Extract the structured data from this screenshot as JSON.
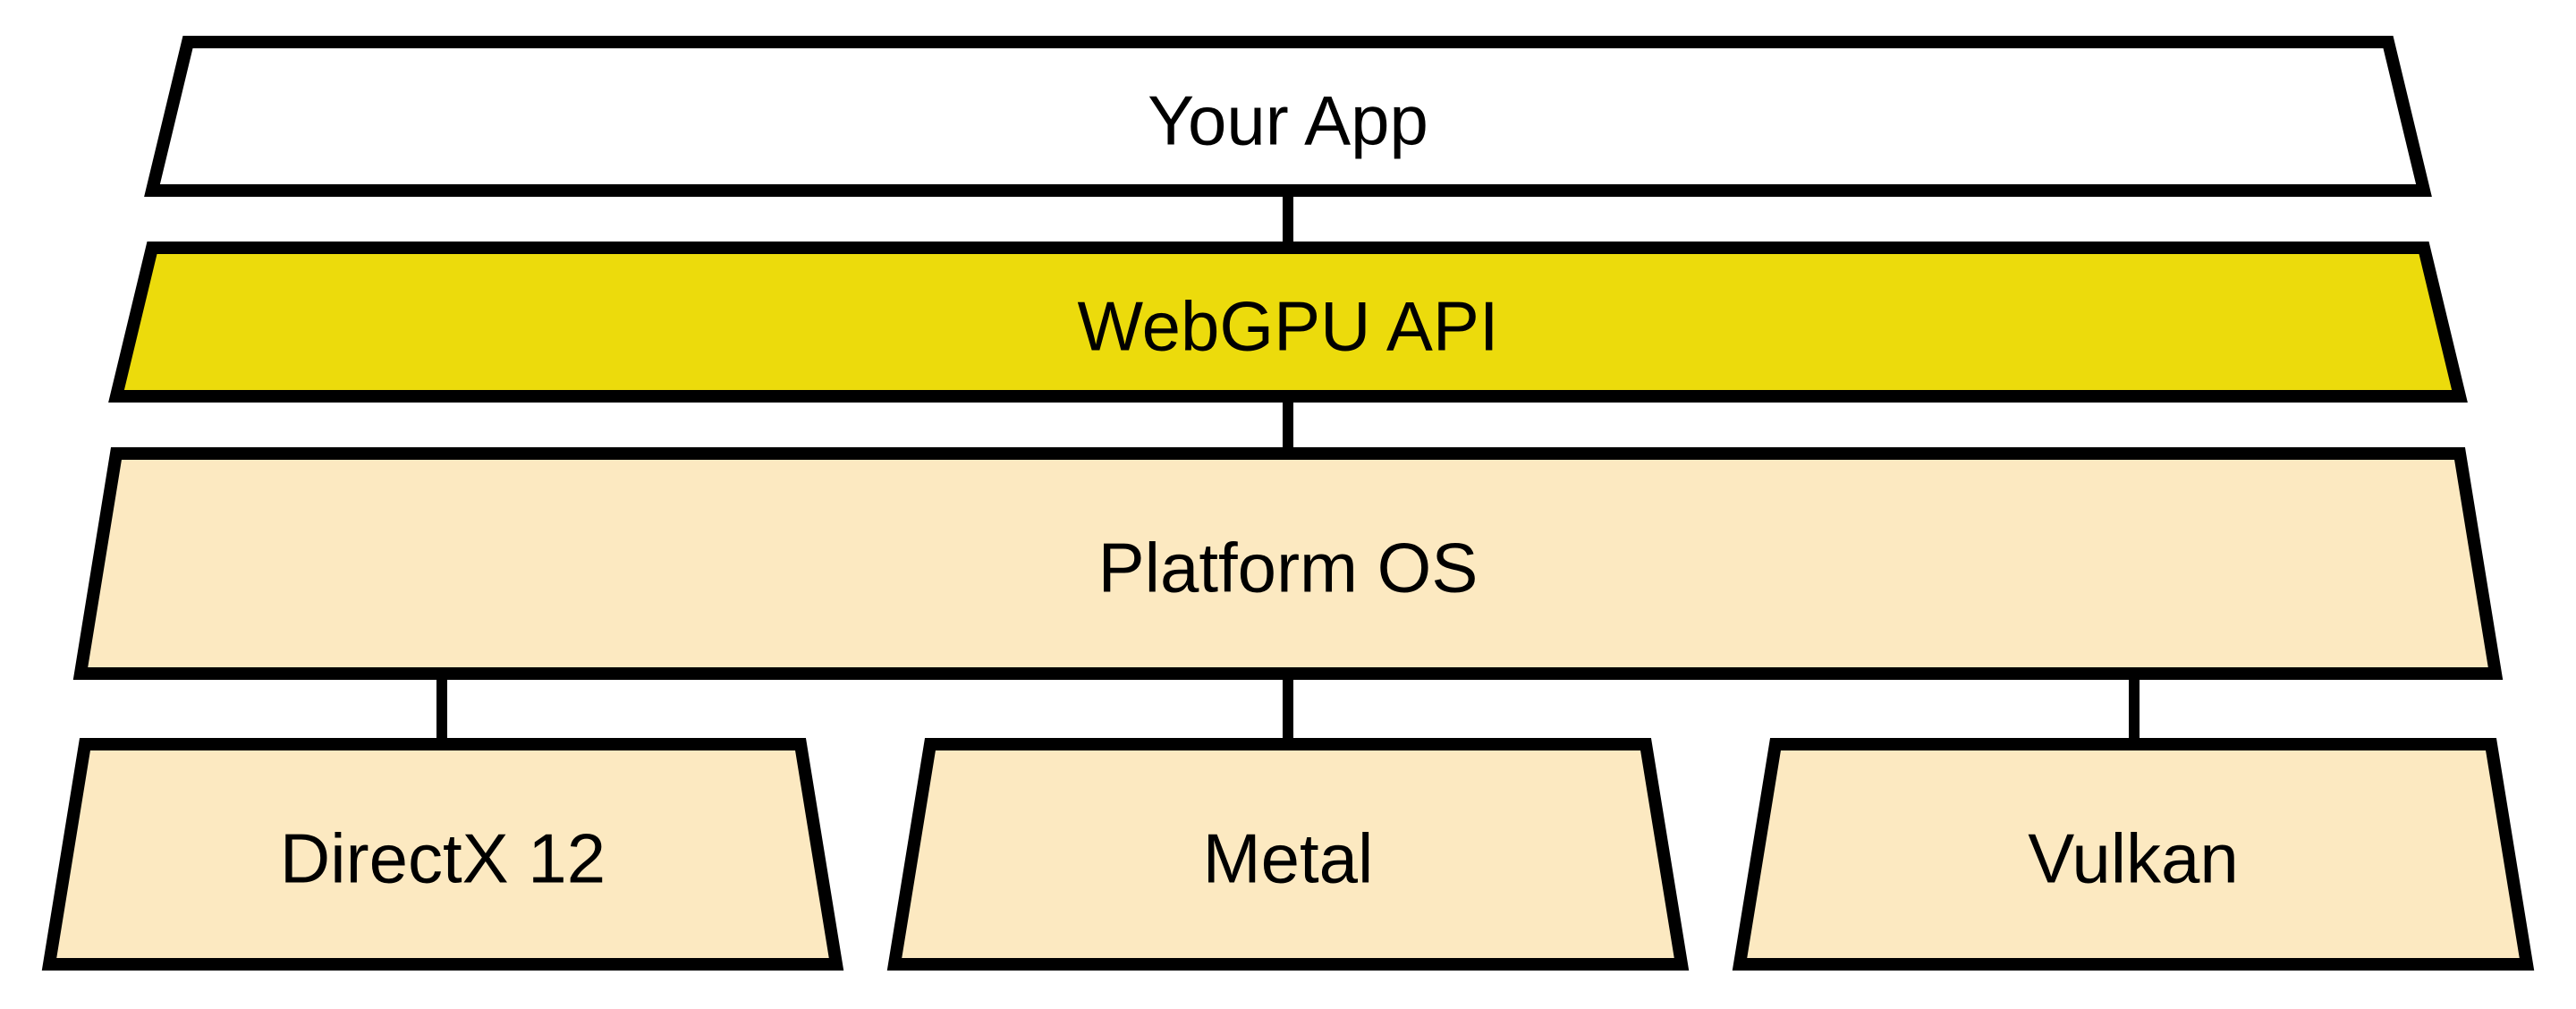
{
  "layers": {
    "app": {
      "label": "Your App",
      "fill": "#ffffff"
    },
    "webgpu": {
      "label": "WebGPU API",
      "fill": "#ecdb0c"
    },
    "platform": {
      "label": "Platform OS",
      "fill": "#fce9c1"
    },
    "backends": [
      {
        "label": "DirectX 12",
        "fill": "#fce9c1"
      },
      {
        "label": "Metal",
        "fill": "#fce9c1"
      },
      {
        "label": "Vulkan",
        "fill": "#fce9c1"
      }
    ]
  },
  "colors": {
    "stroke": "#000000",
    "strokeWidth": 14
  }
}
